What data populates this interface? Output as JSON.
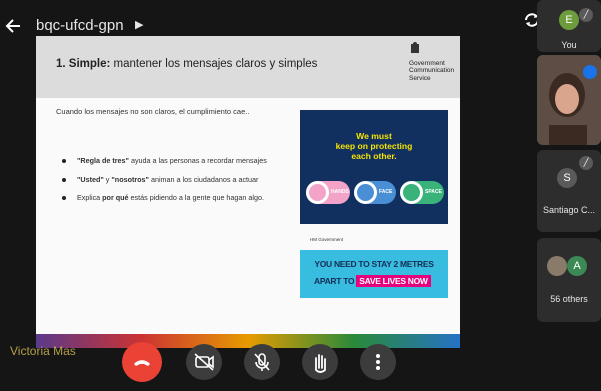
{
  "meeting": {
    "title": "bqc-ufcd-gpn"
  },
  "slide": {
    "title_bold": "1. Simple:",
    "title_rest": " mantener los mensajes claros y simples",
    "gov_logo": [
      "Government",
      "Communication",
      "Service"
    ],
    "intro": "Cuando los mensajes no son claros, el cumplimiento cae..",
    "bullets": [
      {
        "bold": "\"Regla de tres\"",
        "rest": " ayuda a las personas a recordar mensajes"
      },
      {
        "bold": "\"Usted\"",
        "mid": " y ",
        "bold2": "\"nosotros\"",
        "rest": " animan a los ciudadanos a actuar"
      },
      {
        "pre": "Explica ",
        "bold": "por qué",
        "rest": " estás pidiendo a la gente que hagan algo."
      }
    ],
    "poster1": {
      "text": [
        "We must",
        "keep on protecting",
        "each other."
      ],
      "icons": [
        "HANDS",
        "FACE",
        "SPACE"
      ]
    },
    "gov_line": "HM Government",
    "poster2": {
      "line1": "YOU NEED TO STAY 2 METRES",
      "line2_pre": "APART TO",
      "line2_highlight": "SAVE LIVES NOW"
    }
  },
  "presenter_name": "Victoria Mas",
  "participants": {
    "you": {
      "initial": "E",
      "label": "You"
    },
    "santiago": {
      "initial": "S",
      "label": "Santiago C..."
    },
    "others": {
      "initial": "A",
      "label": "56 others"
    }
  },
  "colors": {
    "end_call": "#ea4335",
    "poster_navy": "#12305f",
    "poster_yellow": "#f7e300",
    "poster_cyan": "#38bde0",
    "poster_pink": "#e6007e"
  }
}
